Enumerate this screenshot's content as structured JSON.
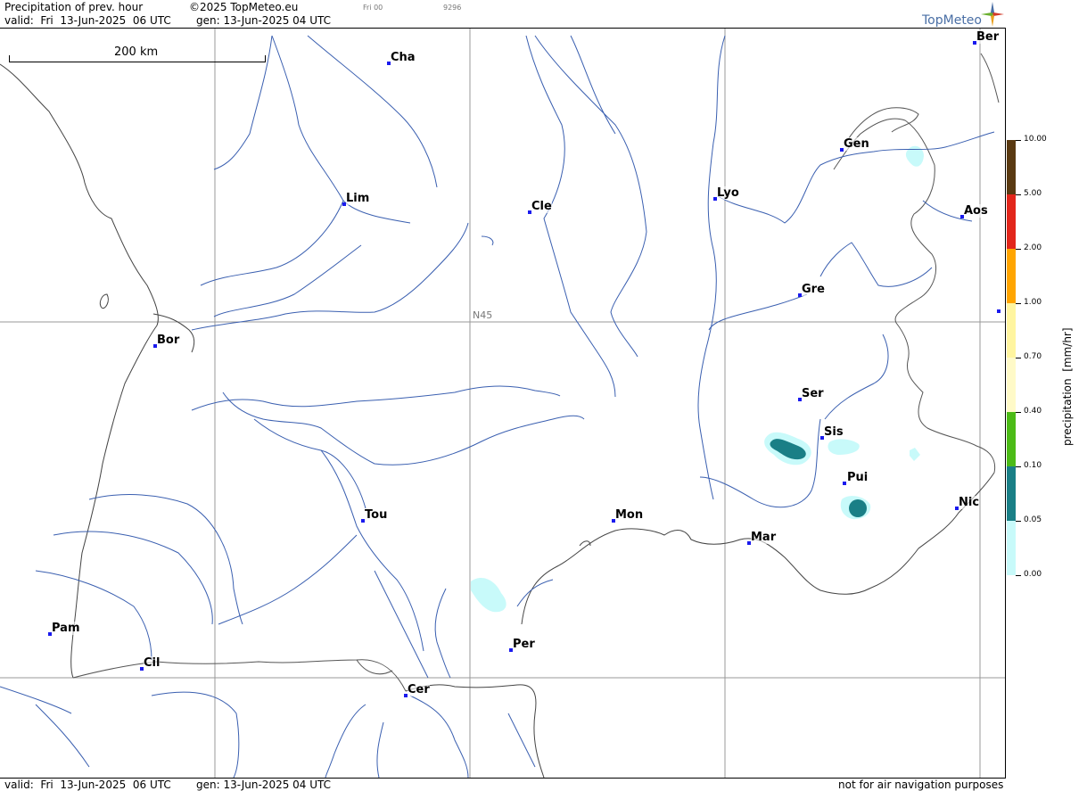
{
  "header": {
    "title": "Precipitation of prev. hour",
    "copyright": "©2025 TopMeteo.eu",
    "run": "Fri 00",
    "code": "9296",
    "valid": "valid:  Fri  13-Jun-2025  06 UTC",
    "gen": "gen: 13-Jun-2025 04 UTC"
  },
  "logo": {
    "text": "TopMeteo",
    "icon": "compass-star-icon"
  },
  "scale_bar": {
    "label": "200 km"
  },
  "grid_label": "N45",
  "cities": [
    {
      "id": "ber",
      "label": "Ber"
    },
    {
      "id": "cha",
      "label": "Cha"
    },
    {
      "id": "gen",
      "label": "Gen"
    },
    {
      "id": "lim",
      "label": "Lim"
    },
    {
      "id": "cle",
      "label": "Cle"
    },
    {
      "id": "lyo",
      "label": "Lyo"
    },
    {
      "id": "aos",
      "label": "Aos"
    },
    {
      "id": "gre",
      "label": "Gre"
    },
    {
      "id": "bor",
      "label": "Bor"
    },
    {
      "id": "ser",
      "label": "Ser"
    },
    {
      "id": "sis",
      "label": "Sis"
    },
    {
      "id": "pui",
      "label": "Pui"
    },
    {
      "id": "nic",
      "label": "Nic"
    },
    {
      "id": "tou",
      "label": "Tou"
    },
    {
      "id": "mon",
      "label": "Mon"
    },
    {
      "id": "mar",
      "label": "Mar"
    },
    {
      "id": "pam",
      "label": "Pam"
    },
    {
      "id": "cil",
      "label": "Cil"
    },
    {
      "id": "per",
      "label": "Per"
    },
    {
      "id": "cer",
      "label": "Cer"
    }
  ],
  "legend": {
    "title": "precipitation  [mm/hr]",
    "levels": [
      "10.00",
      "5.00",
      "2.00",
      "1.00",
      "0.70",
      "0.40",
      "0.10",
      "0.05",
      "0.00"
    ],
    "colors": [
      "#5a3a12",
      "#e2261b",
      "#ffa500",
      "#fff5a0",
      "#fffac8",
      "#4cbb17",
      "#1a7f86",
      "#c8fafa"
    ]
  },
  "footer": {
    "valid": "valid:  Fri  13-Jun-2025  06 UTC",
    "gen": "gen: 13-Jun-2025 04 UTC",
    "note": "not for air navigation purposes"
  },
  "colors": {
    "river": "#3a5fb0",
    "border": "#555555",
    "coast": "#444444",
    "grid": "#999999",
    "city_dot": "#1a1aee"
  }
}
